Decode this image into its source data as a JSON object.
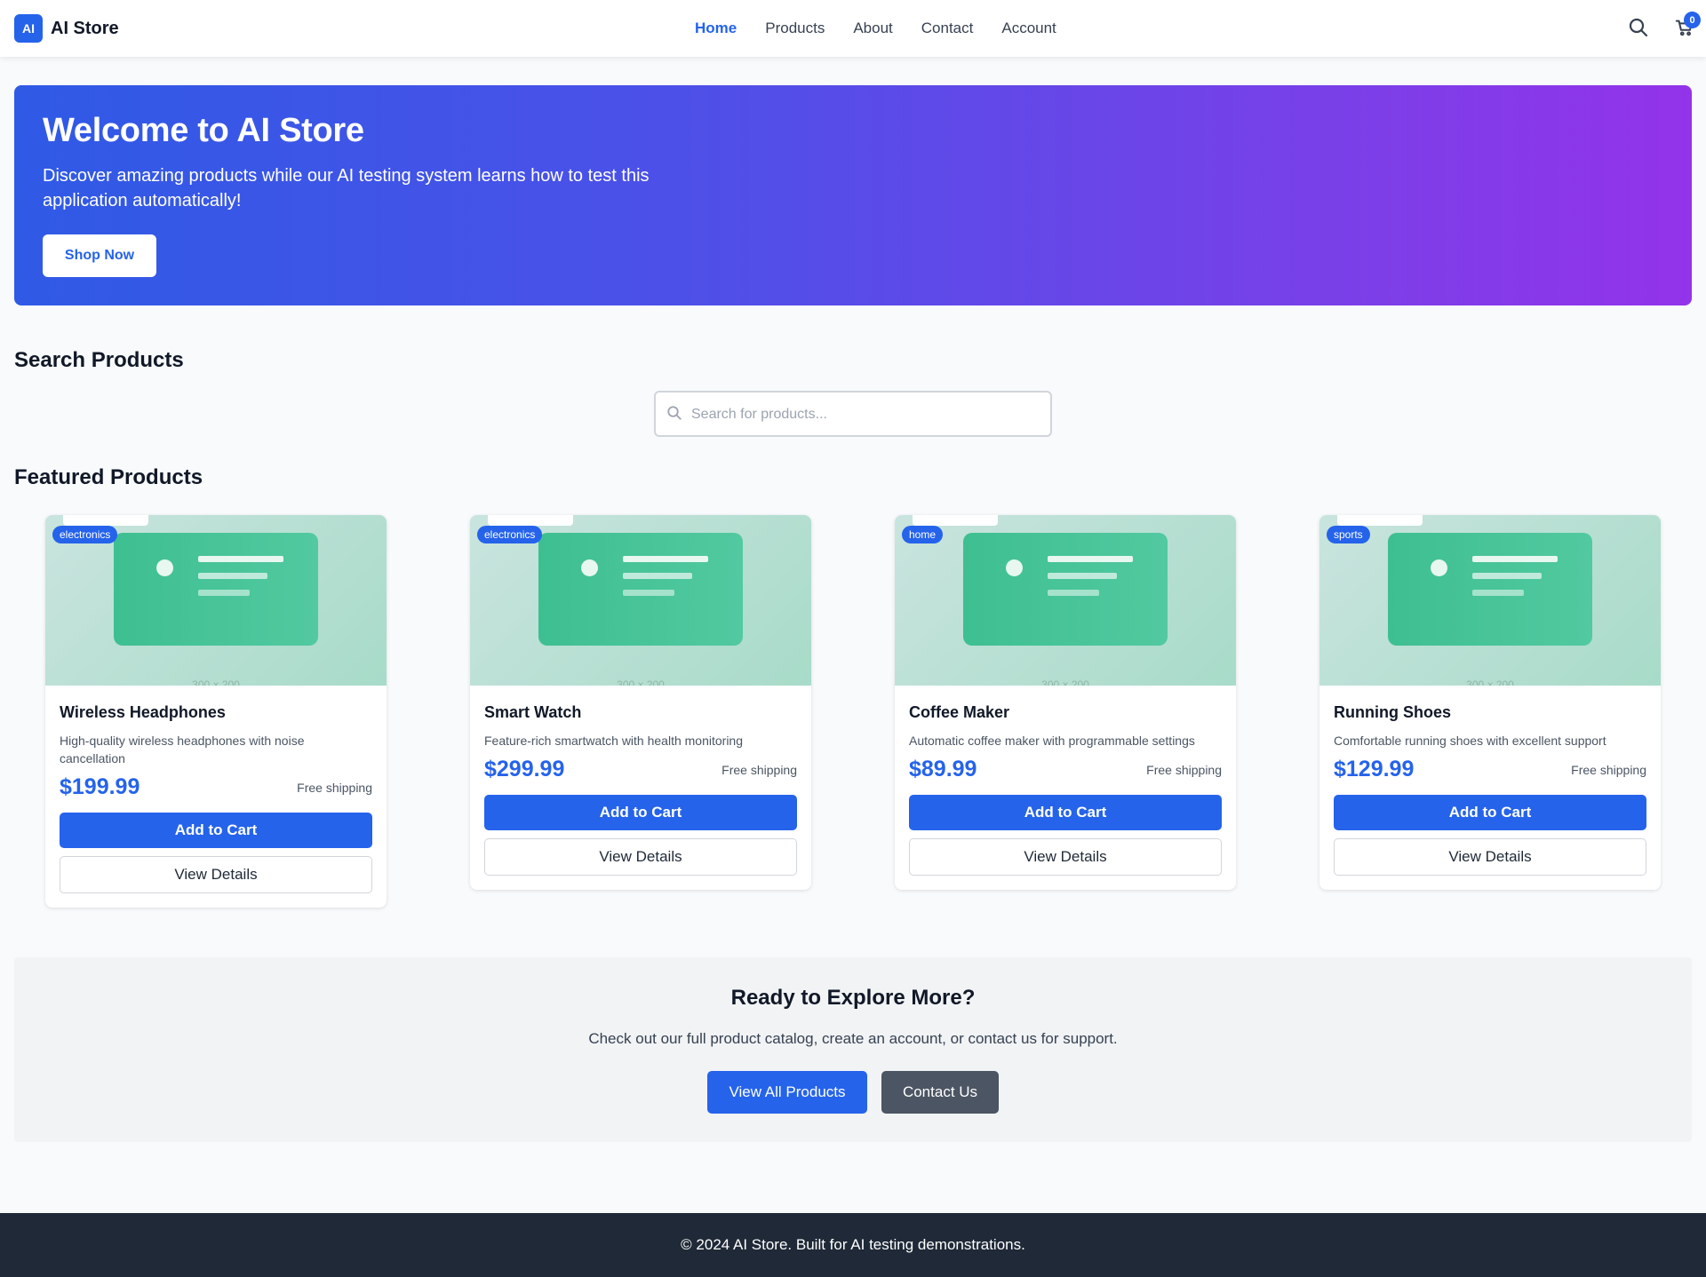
{
  "header": {
    "logo_badge": "AI",
    "logo_text": "AI Store",
    "nav": [
      {
        "label": "Home",
        "active": true
      },
      {
        "label": "Products",
        "active": false
      },
      {
        "label": "About",
        "active": false
      },
      {
        "label": "Contact",
        "active": false
      },
      {
        "label": "Account",
        "active": false
      }
    ],
    "search_icon": "search-icon",
    "cart_icon": "cart-icon",
    "cart_count": "0"
  },
  "hero": {
    "title": "Welcome to AI Store",
    "subtitle": "Discover amazing products while our AI testing system learns how to test this application automatically!",
    "button": "Shop Now"
  },
  "search": {
    "heading": "Search Products",
    "placeholder": "Search for products...",
    "value": ""
  },
  "featured": {
    "heading": "Featured Products",
    "placeholder_dims": "300 × 200",
    "products": [
      {
        "category": "electronics",
        "name": "Wireless Headphones",
        "description": "High-quality wireless headphones with noise cancellation",
        "price": "$199.99",
        "shipping": "Free shipping",
        "add_label": "Add to Cart",
        "details_label": "View Details"
      },
      {
        "category": "electronics",
        "name": "Smart Watch",
        "description": "Feature-rich smartwatch with health monitoring",
        "price": "$299.99",
        "shipping": "Free shipping",
        "add_label": "Add to Cart",
        "details_label": "View Details"
      },
      {
        "category": "home",
        "name": "Coffee Maker",
        "description": "Automatic coffee maker with programmable settings",
        "price": "$89.99",
        "shipping": "Free shipping",
        "add_label": "Add to Cart",
        "details_label": "View Details"
      },
      {
        "category": "sports",
        "name": "Running Shoes",
        "description": "Comfortable running shoes with excellent support",
        "price": "$129.99",
        "shipping": "Free shipping",
        "add_label": "Add to Cart",
        "details_label": "View Details"
      }
    ]
  },
  "cta": {
    "title": "Ready to Explore More?",
    "text": "Check out our full product catalog, create an account, or contact us for support.",
    "primary": "View All Products",
    "secondary": "Contact Us"
  },
  "footer": {
    "text": "© 2024 AI Store. Built for AI testing demonstrations."
  },
  "colors": {
    "primary": "#2563eb",
    "hero_gradient_start": "#2f5ae6",
    "hero_gradient_end": "#9333ea",
    "footer_bg": "#1f2937",
    "secondary_button": "#4b5563"
  }
}
